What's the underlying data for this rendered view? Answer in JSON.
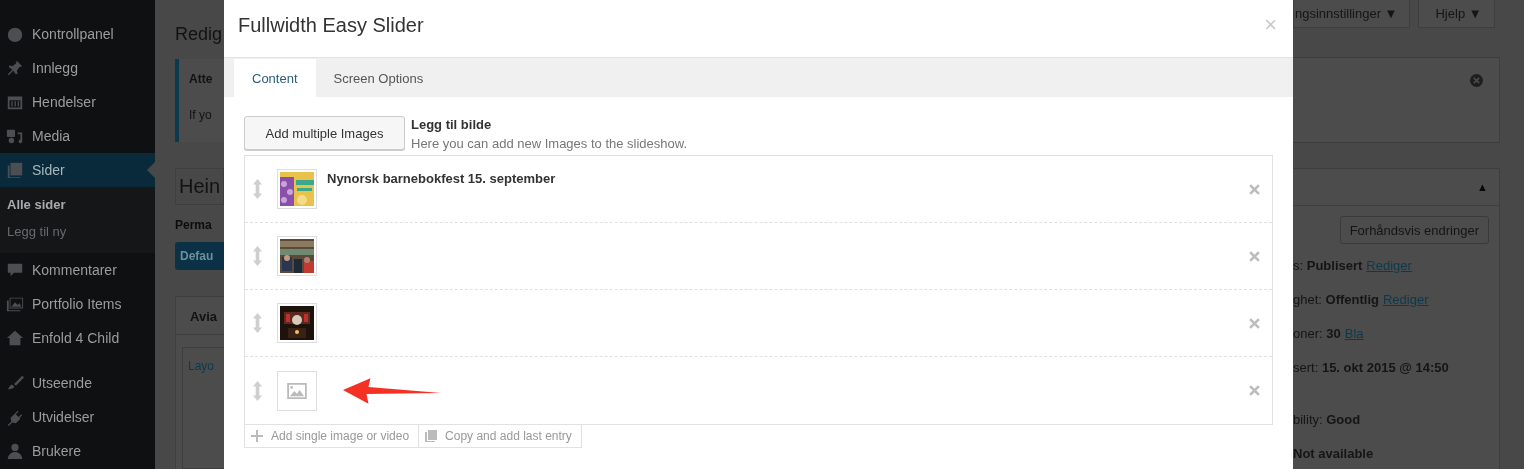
{
  "sidebar": {
    "items": [
      {
        "label": "Kontrollpanel",
        "selected": false
      },
      {
        "label": "Innlegg",
        "selected": false
      },
      {
        "label": "Hendelser",
        "selected": false
      },
      {
        "label": "Media",
        "selected": false
      },
      {
        "label": "Sider",
        "selected": true,
        "children": [
          {
            "label": "Alle sider",
            "selected": true
          },
          {
            "label": "Legg til ny",
            "selected": false
          }
        ]
      },
      {
        "label": "Kommentarer",
        "selected": false
      },
      {
        "label": "Portfolio Items",
        "selected": false
      },
      {
        "label": "Enfold 4 Child",
        "selected": false
      },
      {
        "label": "Utseende",
        "selected": false
      },
      {
        "label": "Utvidelser",
        "selected": false
      },
      {
        "label": "Brukere",
        "selected": false
      }
    ]
  },
  "page_left": {
    "heading": "Redig",
    "notice_title": "Atte",
    "notice_text": "If yo",
    "title_field": "Hein",
    "permalink": "Perma",
    "template_button": "Defau",
    "box_title": "Avia",
    "box_link": "Layo"
  },
  "page_right": {
    "screen_options": "ngsinnstillinger ▼",
    "help": "Hjelp ▼",
    "collapse": "▲",
    "preview_button": "Forhåndsvis endringer",
    "lines": [
      {
        "text": "s: **Publisert**",
        "link": "Rediger"
      },
      {
        "text": "ghet: **Offentlig**",
        "link": "Rediger"
      },
      {
        "text": "oner: **30**",
        "link": "Bla"
      },
      {
        "text": "sert: **15. okt 2015 @ 14:50**"
      },
      {
        "text": "bility: **Good**"
      },
      {
        "text": "**Not available**"
      }
    ]
  },
  "modal": {
    "title": "Fullwidth Easy Slider",
    "close": "×",
    "tabs": [
      {
        "label": "Content",
        "selected": true
      },
      {
        "label": "Screen Options",
        "selected": false
      }
    ],
    "add_multiple_button": "Add multiple Images",
    "add_title": "Legg til bilde",
    "add_description": "Here you can add new Images to the slideshow.",
    "slides": [
      {
        "kind": "picture",
        "title": "Nynorsk barnebokfest 15. september",
        "annotated": false
      },
      {
        "kind": "picture",
        "annotated": false
      },
      {
        "kind": "picture",
        "annotated": false
      },
      {
        "kind": "empty",
        "annotated": true
      }
    ],
    "footer_buttons": [
      {
        "label": "Add single image or video"
      },
      {
        "label": "Copy and add last entry"
      }
    ]
  }
}
